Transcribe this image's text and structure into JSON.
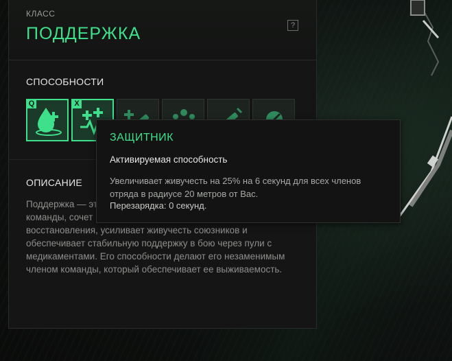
{
  "header": {
    "class_caption": "КЛАСС",
    "class_name": "ПОДДЕРЖКА",
    "help_label": "?"
  },
  "abilities": {
    "title": "СПОСОБНОСТИ",
    "items": [
      {
        "key": "Q",
        "icon": "healing-drop-icon",
        "state": "active"
      },
      {
        "key": "X",
        "icon": "defender-pulse-icon",
        "state": "active"
      },
      {
        "key": "",
        "icon": "syringe-plus-icon",
        "state": "inactive"
      },
      {
        "key": "",
        "icon": "squad-group-icon",
        "state": "inactive"
      },
      {
        "key": "",
        "icon": "syringe-icon",
        "state": "inactive"
      },
      {
        "key": "",
        "icon": "pill-icon",
        "state": "inactive"
      }
    ]
  },
  "description": {
    "title": "ОПИСАНИЕ",
    "text_visible_start": "Поддержка — эт",
    "line2_visible": "команды, сочет",
    "text_rest": "восстановления, усиливает живучесть союзников и обеспечивает стабильную поддержку в бою через пули с медикаментами. Его способности делают его незаменимым членом команды, который обеспечивает ее выживаемость."
  },
  "tooltip": {
    "title": "ЗАЩИТНИК",
    "type": "Активируемая способность",
    "description": "Увеличивает живучесть на 25% на 6 секунд для всех членов отряда в радиусе 20 метров от Вас.",
    "cooldown": "Перезарядка: 0 секунд."
  },
  "colors": {
    "accent": "#3fe08c",
    "panel_bg": "#141514",
    "text_primary": "#e6e7e4",
    "text_muted": "#8d8f8c"
  }
}
